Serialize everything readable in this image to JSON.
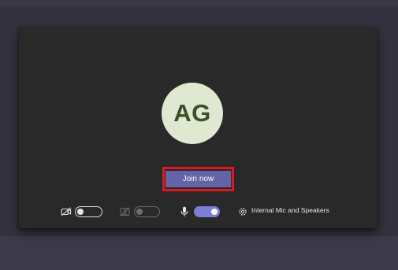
{
  "prejoin": {
    "avatar_initials": "AG",
    "join_label": "Join now",
    "camera_toggle_state": "off",
    "background_toggle_state": "disabled",
    "mic_toggle_state": "on",
    "audio_device_label": "Internal Mic and Speakers"
  },
  "colors": {
    "background": "#34323f",
    "panel": "#292929",
    "avatar_bg": "#dfe8d0",
    "avatar_text": "#3a4f2a",
    "join_button": "#6264a7",
    "highlight": "#e8141a",
    "toggle_on": "#7b7fd6"
  },
  "icons": {
    "camera": "camera-off-icon",
    "background": "background-effects-icon",
    "mic": "microphone-icon",
    "settings": "gear-icon"
  }
}
